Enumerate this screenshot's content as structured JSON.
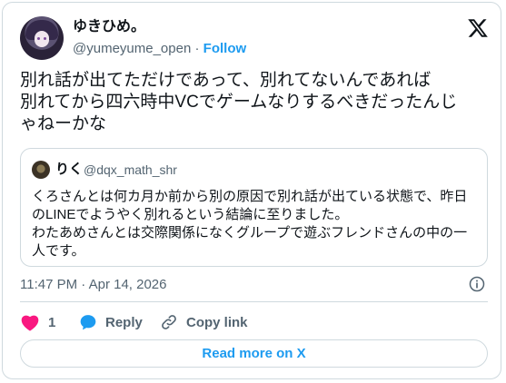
{
  "author": {
    "display_name": "ゆきひめ。",
    "handle": "@yumeyume_open",
    "separator": "·",
    "follow_label": "Follow"
  },
  "tweet": {
    "lines": [
      "別れ話が出てただけであって、別れてないんであれば",
      "別れてから四六時中VCでゲームなりするべきだったんじ",
      "ゃねーかな"
    ]
  },
  "quoted_tweet": {
    "display_name": "りく",
    "handle": "@dqx_math_shr",
    "lines": [
      "くろさんとは何カ月か前から別の原因で別れ話が出ている状態で、昨日",
      "のLINEでようやく別れるという結論に至りました。",
      "わたあめさんとは交際関係になくグループで遊ぶフレンドさんの中の一",
      "人です。"
    ]
  },
  "timestamp": "11:47 PM · Apr 14, 2026",
  "actions": {
    "like_count": "1",
    "reply_label": "Reply",
    "copy_link_label": "Copy link"
  },
  "read_more_label": "Read more on X",
  "colors": {
    "accent": "#1d9bf0",
    "like": "#f91880",
    "text": "#0f1419",
    "secondary": "#536471",
    "border": "#cfd9de"
  },
  "icons": [
    "x-logo-icon",
    "info-icon",
    "heart-icon",
    "reply-bubble-icon",
    "link-icon"
  ]
}
